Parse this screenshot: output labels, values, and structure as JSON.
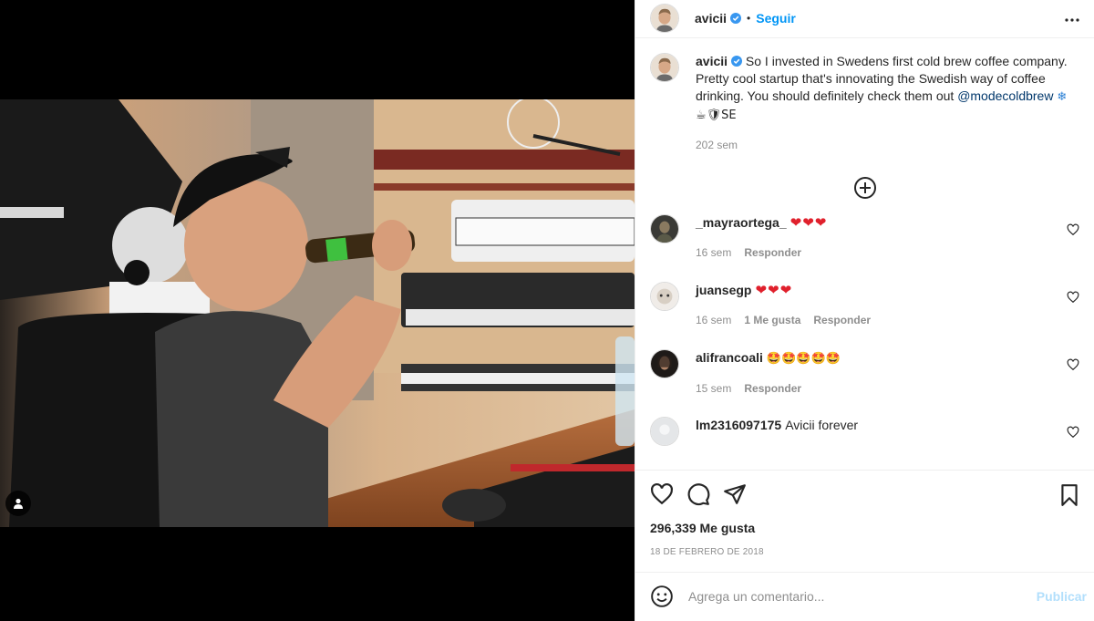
{
  "post": {
    "author": "avicii",
    "follow_label": "Seguir",
    "separator": "•",
    "caption_text": "So I invested in Swedens first cold brew coffee company. Pretty cool startup that's innovating the Swedish way of coffee drinking. You should definitely check them out ",
    "caption_mention": "@modecoldbrew",
    "caption_emojis_1": "❄",
    "caption_emojis_2": "☕🛡SE",
    "caption_time": "202 sem"
  },
  "comments": [
    {
      "username": "_mayraortega_",
      "text": "❤❤❤",
      "time": "16 sem",
      "likes": "",
      "reply": "Responder"
    },
    {
      "username": "juansegp",
      "text": "❤❤❤",
      "time": "16 sem",
      "likes": "1 Me gusta",
      "reply": "Responder"
    },
    {
      "username": "alifrancoali",
      "text": "🤩🤩🤩🤩🤩",
      "time": "15 sem",
      "likes": "",
      "reply": "Responder"
    },
    {
      "username": "lm2316097175",
      "text": "Avicii forever",
      "time": "",
      "likes": "",
      "reply": ""
    }
  ],
  "stats": {
    "likes": "296,339 Me gusta",
    "date": "18 DE FEBRERO DE 2018"
  },
  "composer": {
    "placeholder": "Agrega un comentario...",
    "publish_label": "Publicar"
  },
  "icons": {
    "more": "more-options-icon",
    "verified": "verified-badge-icon",
    "load_more": "plus-circle-icon",
    "like": "heart-icon",
    "comment": "comment-bubble-icon",
    "share": "send-icon",
    "save": "bookmark-icon",
    "emoji": "emoji-icon",
    "tag": "user-tag-icon"
  },
  "colors": {
    "link": "#0095f6",
    "mention": "#00376b",
    "muted": "#8e8e8e",
    "publish_disabled": "#b2dffc",
    "heart": "#e0202c"
  }
}
